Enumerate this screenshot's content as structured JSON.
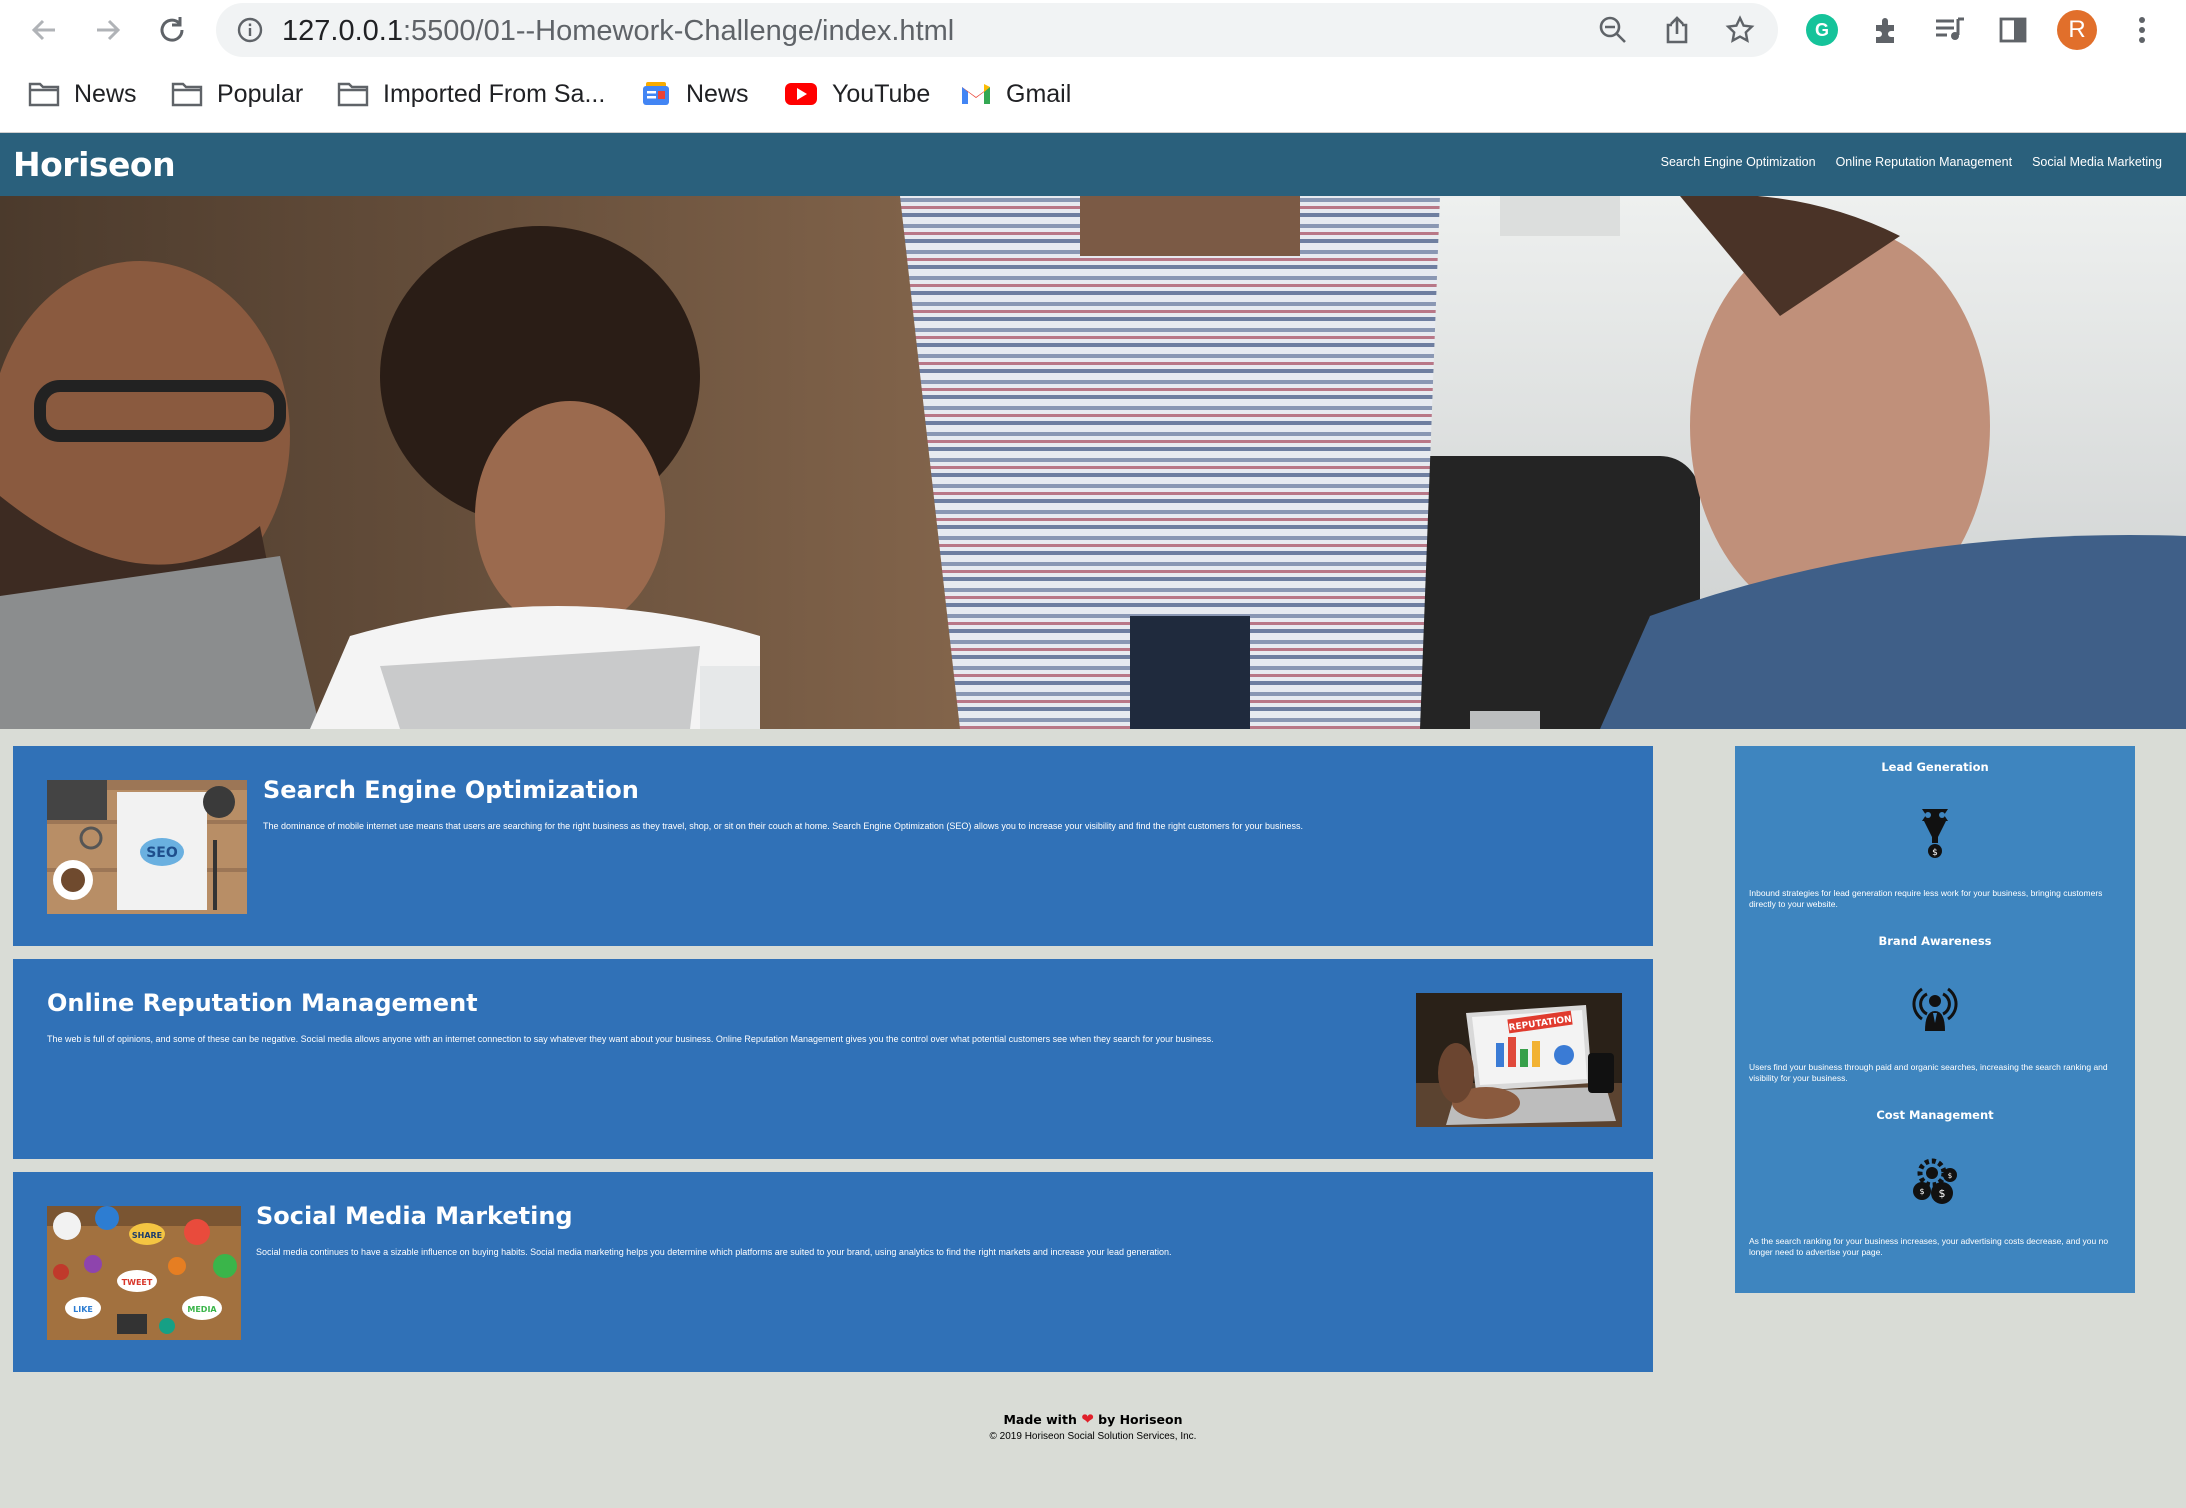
{
  "browser": {
    "url_host": "127.0.0.1",
    "url_path": ":5500/01--Homework-Challenge/index.html",
    "profile_initial": "R",
    "bookmarks": [
      {
        "label": "News",
        "icon": "folder-icon"
      },
      {
        "label": "Popular",
        "icon": "folder-icon"
      },
      {
        "label": "Imported From Sa...",
        "icon": "folder-icon"
      },
      {
        "label": "News",
        "icon": "google-news-icon"
      },
      {
        "label": "YouTube",
        "icon": "youtube-icon"
      },
      {
        "label": "Gmail",
        "icon": "gmail-icon"
      }
    ]
  },
  "header": {
    "logo": "Horiseon",
    "nav": [
      "Search Engine Optimization",
      "Online Reputation Management",
      "Social Media Marketing"
    ]
  },
  "content": [
    {
      "title": "Search Engine Optimization",
      "text": "The dominance of mobile internet use means that users are searching for the right business as they travel, shop, or sit on their couch at home. Search Engine Optimization (SEO) allows you to increase your visibility and find the right customers for your business.",
      "image": "seo-image"
    },
    {
      "title": "Online Reputation Management",
      "text": "The web is full of opinions, and some of these can be negative. Social media allows anyone with an internet connection to say whatever they want about your business. Online Reputation Management gives you the control over what potential customers see when they search for your business.",
      "image": "reputation-image",
      "image_label": "REPUTATION"
    },
    {
      "title": "Social Media Marketing",
      "text": "Social media continues to have a sizable influence on buying habits. Social media marketing helps you determine which platforms are suited to your brand, using analytics to find the right markets and increase your lead generation.",
      "image": "social-media-image",
      "bubble_words": [
        "SHARE",
        "TWEET",
        "LIKE",
        "MEDIA"
      ]
    }
  ],
  "benefits": [
    {
      "title": "Lead Generation",
      "icon": "lead-generation-icon",
      "text": "Inbound strategies for lead generation require less work for your business, bringing customers directly to your website."
    },
    {
      "title": "Brand Awareness",
      "icon": "brand-awareness-icon",
      "text": "Users find your business through paid and organic searches, increasing the search ranking and visibility for your business."
    },
    {
      "title": "Cost Management",
      "icon": "cost-management-icon",
      "text": "As the search ranking for your business increases, your advertising costs decrease, and you no longer need to advertise your page."
    }
  ],
  "footer": {
    "made_prefix": "Made with",
    "heart": "❤",
    "made_suffix": "by Horiseon",
    "copyright": "© 2019 Horiseon Social Solution Services, Inc."
  },
  "colors": {
    "header": "#2a607c",
    "card": "#3071b7",
    "benefits": "#3e85bf",
    "page_bg": "#d9dcd6"
  }
}
